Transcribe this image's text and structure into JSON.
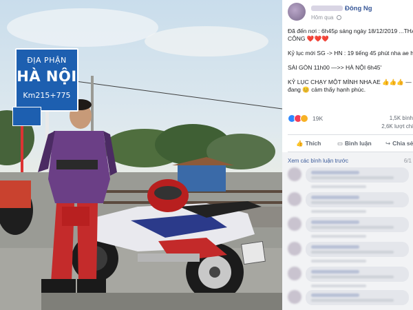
{
  "photo": {
    "sign": {
      "line1": "ĐỊA PHẬN",
      "line2": "HÀ NỘI",
      "line3": "Km215+775"
    }
  },
  "post": {
    "author_name": "Đông Ng",
    "time": "Hôm qua",
    "body": {
      "line1": "Đã đến nơi : 6h45p sáng ngày 18/12/2019 ...THÀ",
      "line2": "CÔNG ❤️❤️❤️",
      "line3": "Kỷ lục mới SG -> HN : 19 tiếng 45 phút nha ae hả",
      "line4": "SÀI GÒN 11h00 —>> HÀ NỘI 6h45'",
      "line5": "KỶ LỤC CHẠY MỘT MÌNH NHA AE 👍👍👍 —",
      "line6": "đang 😊 cảm thấy hạnh phúc."
    },
    "reaction_count": "19K",
    "comment_count": "1,5K bình",
    "share_count": "2,6K lượt chi"
  },
  "actions": {
    "like": "Thích",
    "comment": "Bình luận",
    "share": "Chia sẻ"
  },
  "comments_section": {
    "view_more": "Xem các bình luận trước",
    "page_indicator": "6/1"
  },
  "icons": {
    "like_reaction": "like-reaction-icon",
    "love_reaction": "love-reaction-icon",
    "wow_reaction": "wow-reaction-icon",
    "like_action": "thumbs-up-icon",
    "comment_action": "comment-icon",
    "share_action": "share-icon"
  },
  "colors": {
    "link": "#385898",
    "sign_blue": "#1d5fb0",
    "comments_bg": "#f2f3f5"
  }
}
